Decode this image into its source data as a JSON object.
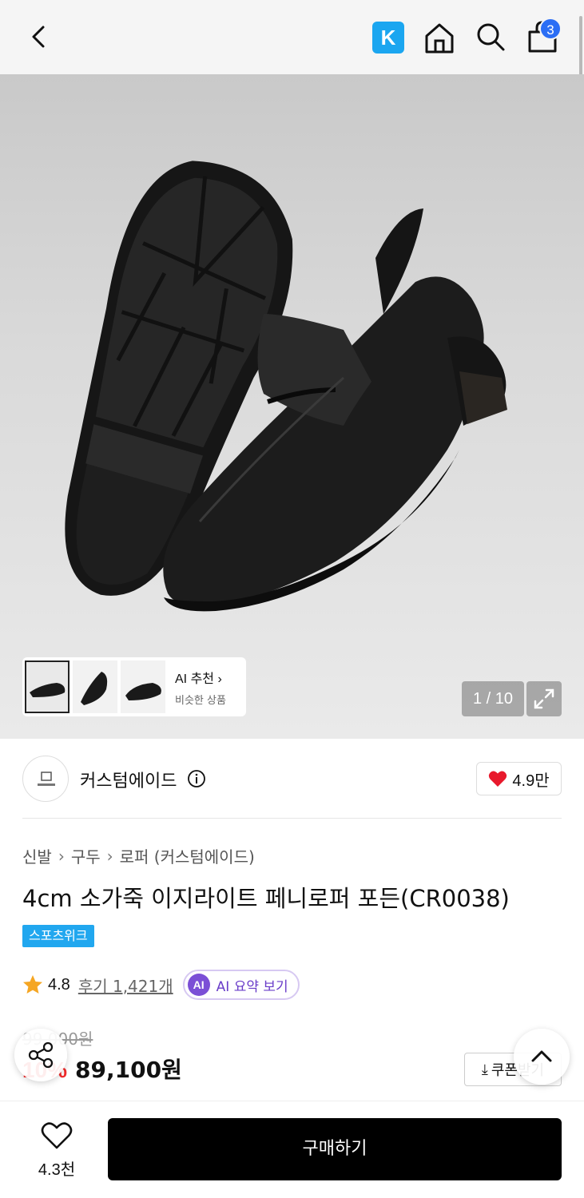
{
  "topbar": {
    "k_label": "K",
    "cart_count": "3",
    "icons": [
      "back-chevron",
      "k-store",
      "home",
      "search",
      "shopping-bag"
    ]
  },
  "gallery": {
    "counter": "1 / 10",
    "ai_recommend": {
      "title": "AI 추천",
      "subtitle": "비슷한 상품"
    }
  },
  "brand": {
    "name": "커스텀에이드",
    "likes": "4.9만"
  },
  "breadcrumb": [
    "신발",
    "구두",
    "로퍼 (커스텀에이드)"
  ],
  "product": {
    "title": "4cm 소가죽 이지라이트 페니로퍼 포든(CR0038)",
    "tag": "스포츠위크",
    "rating": "4.8",
    "reviews": "후기 1,421개",
    "ai_summary": {
      "badge": "AI",
      "label": "AI 요약 보기"
    },
    "original_price": "99,000원",
    "discount": "10%",
    "price": "89,100원",
    "coupon_label": "쿠폰받기"
  },
  "bottom": {
    "wish_count": "4.3천",
    "buy_label": "구매하기"
  },
  "colors": {
    "accent_blue": "#1ba6f0",
    "badge_blue": "#2b6ef5",
    "sale_red": "#f32b2b",
    "ai_purple": "#7b4fd6",
    "heart_red": "#e8192c"
  }
}
